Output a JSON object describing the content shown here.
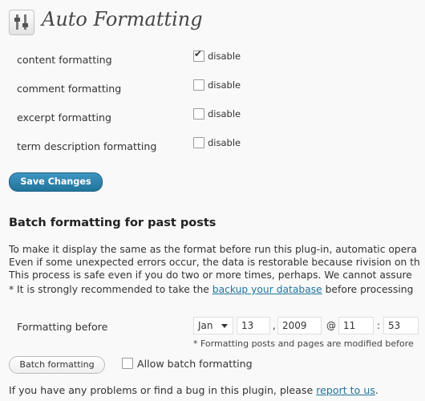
{
  "page": {
    "title": "Auto Formatting"
  },
  "settings": [
    {
      "label": "content formatting",
      "checkbox_label": "disable",
      "checked": true
    },
    {
      "label": "comment formatting",
      "checkbox_label": "disable",
      "checked": false
    },
    {
      "label": "excerpt formatting",
      "checkbox_label": "disable",
      "checked": false
    },
    {
      "label": "term description formatting",
      "checkbox_label": "disable",
      "checked": false
    }
  ],
  "save_button": "Save Changes",
  "batch": {
    "title": "Batch formatting for past posts",
    "lines": [
      "To make it display the same as the format before run this plug-in, automatic opera",
      "Even if some unexpected errors occur, the data is restorable because rivision on th",
      "This process is safe even if you do two or more times, perhaps. We cannot assure"
    ],
    "note_prefix": "* It is strongly recommended to take the ",
    "note_link": "backup your database",
    "note_suffix": " before processing",
    "formatting_before_label": "Formatting before",
    "month": "Jan",
    "day": "13",
    "comma": ",",
    "year": "2009",
    "at": "@",
    "hour": "11",
    "colon": ":",
    "minute": "53",
    "hint": "* Formatting posts and pages are modified before",
    "batch_button": "Batch formatting",
    "allow_label": "Allow batch formatting",
    "allow_checked": false
  },
  "footer": {
    "prefix": "If you have any problems or find a bug in this plugin, please ",
    "link": "report to us",
    "suffix": "."
  }
}
